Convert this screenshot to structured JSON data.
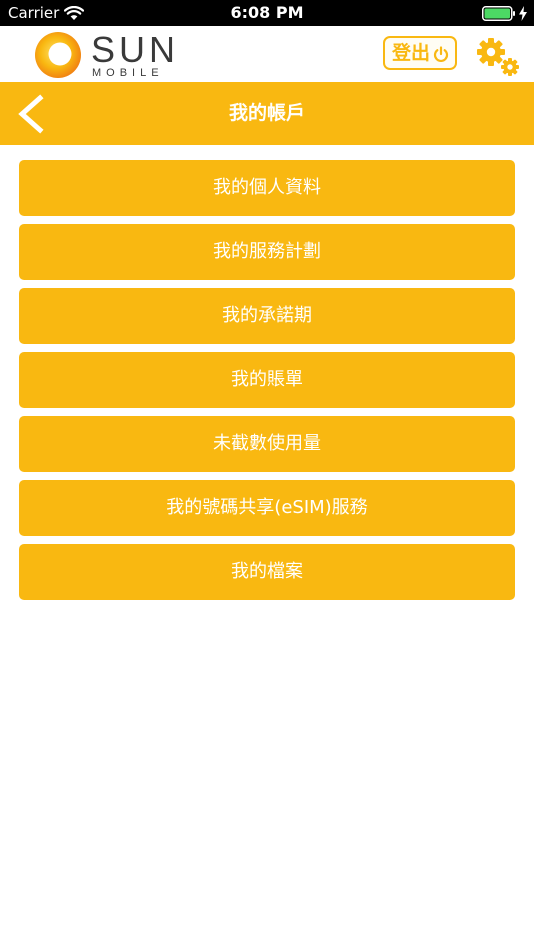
{
  "status_bar": {
    "carrier": "Carrier",
    "time": "6:08 PM",
    "wifi_icon": "wifi-icon",
    "battery_icon": "battery-icon",
    "charging_icon": "charging-bolt-icon"
  },
  "header": {
    "logo_text": "SUN",
    "logo_subtext": "MOBILE",
    "logout_label": "登出",
    "logout_icon": "power-icon",
    "settings_icon": "gear-icon"
  },
  "title_bar": {
    "title": "我的帳戶",
    "back_icon": "chevron-left-icon"
  },
  "menu": {
    "items": [
      {
        "label": "我的個人資料"
      },
      {
        "label": "我的服務計劃"
      },
      {
        "label": "我的承諾期"
      },
      {
        "label": "我的賬單"
      },
      {
        "label": "未截數使用量"
      },
      {
        "label": "我的號碼共享(eSIM)服務"
      },
      {
        "label": "我的檔案"
      }
    ]
  },
  "colors": {
    "accent": "#f9b811",
    "status_bar_bg": "#000000",
    "battery_green": "#4cd964",
    "logo_text": "#3a3a3a"
  }
}
